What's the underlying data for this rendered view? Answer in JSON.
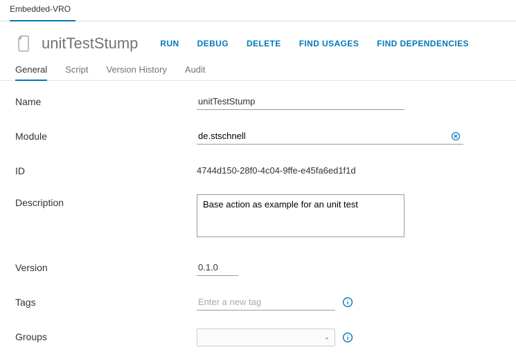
{
  "top_tab": "Embedded-VRO",
  "title": "unitTestStump",
  "actions": {
    "run": "RUN",
    "debug": "DEBUG",
    "delete": "DELETE",
    "find_usages": "FIND USAGES",
    "find_dependencies": "FIND DEPENDENCIES"
  },
  "tabs": {
    "general": "General",
    "script": "Script",
    "version_history": "Version History",
    "audit": "Audit"
  },
  "form": {
    "name_label": "Name",
    "name_value": "unitTestStump",
    "module_label": "Module",
    "module_value": "de.stschnell",
    "id_label": "ID",
    "id_value": "4744d150-28f0-4c04-9ffe-e45fa6ed1f1d",
    "description_label": "Description",
    "description_value": "Base action as example for an unit test",
    "version_label": "Version",
    "version_value": "0.1.0",
    "tags_label": "Tags",
    "tags_placeholder": "Enter a new tag",
    "groups_label": "Groups"
  }
}
